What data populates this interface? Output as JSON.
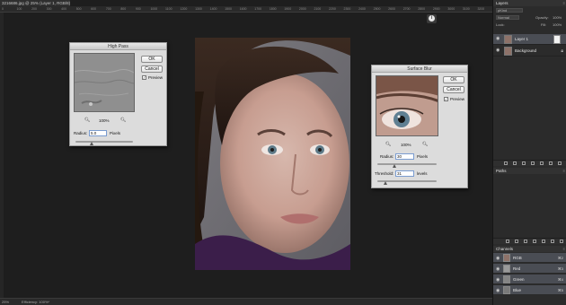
{
  "document": {
    "tab_label": "3216686.jpg @ 25% (Layer 1, RGB/8)",
    "zoom": "25%",
    "efficiency": "Efficiency: 100%*"
  },
  "ruler": {
    "ticks": [
      "0",
      "100",
      "200",
      "300",
      "400",
      "500",
      "600",
      "700",
      "800",
      "900",
      "1000",
      "1100",
      "1200",
      "1300",
      "1400",
      "1500",
      "1600",
      "1700",
      "1800",
      "1900",
      "2000",
      "2100",
      "2200",
      "2300",
      "2400",
      "2500",
      "2600",
      "2700",
      "2800",
      "2900",
      "3000",
      "3100",
      "3200"
    ]
  },
  "high_pass": {
    "title": "High Pass",
    "ok": "OK",
    "cancel": "Cancel",
    "preview": "Preview",
    "preview_checked": true,
    "zoom_level": "100%",
    "radius_label": "Radius:",
    "radius_value": "5.0",
    "radius_unit": "Pixels"
  },
  "surface_blur": {
    "title": "Surface Blur",
    "ok": "OK",
    "cancel": "Cancel",
    "preview": "Preview",
    "preview_checked": true,
    "zoom_level": "100%",
    "radius_label": "Radius:",
    "radius_value": "30",
    "radius_unit": "Pixels",
    "threshold_label": "Threshold:",
    "threshold_value": "31",
    "threshold_unit": "levels"
  },
  "layers_panel": {
    "tab": "Layers",
    "kind": "pKind",
    "blend_mode": "Normal",
    "opacity_label": "Opacity:",
    "opacity": "100%",
    "lock_label": "Lock:",
    "fill_label": "Fill:",
    "fill": "100%",
    "layers": [
      {
        "name": "Layer 1",
        "selected": true
      },
      {
        "name": "Background",
        "selected": false
      }
    ]
  },
  "paths_panel": {
    "tab": "Paths"
  },
  "channels_panel": {
    "tab": "Channels",
    "channels": [
      {
        "name": "RGB",
        "shortcut": "⌘2"
      },
      {
        "name": "Red",
        "shortcut": "⌘3"
      },
      {
        "name": "Green",
        "shortcut": "⌘4"
      },
      {
        "name": "Blue",
        "shortcut": "⌘5"
      }
    ]
  },
  "colors": {
    "ui_dark": "#1e1e1e",
    "panel": "#2b2b2b",
    "dialog": "#dcdcdc",
    "selection": "#4a4d54",
    "field_focus": "#7a9cd0"
  },
  "icons": [
    "info-icon",
    "zoom-out-icon",
    "zoom-in-icon",
    "eye-icon",
    "lock-icon",
    "collapse-icon"
  ]
}
